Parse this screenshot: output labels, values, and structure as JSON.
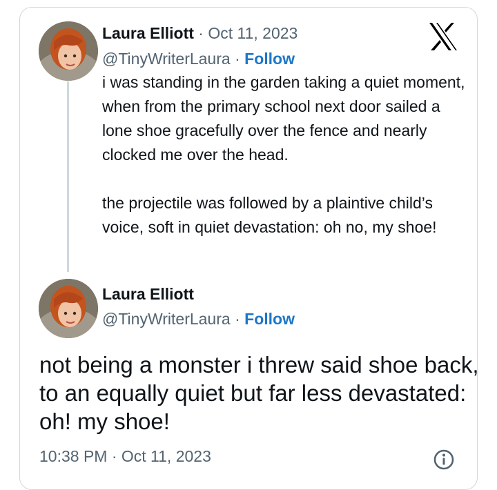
{
  "tweet1": {
    "author_name": "Laura Elliott",
    "separator": "·",
    "date": "Oct 11, 2023",
    "handle": "@TinyWriterLaura",
    "follow_label": "Follow",
    "paragraph1": "i was standing in the garden taking a quiet moment, when from the primary school next door sailed a lone shoe gracefully over the fence and nearly clocked me over the head.",
    "paragraph2": "the projectile was followed by a plaintive child’s voice, soft in quiet devastation: oh no, my shoe!"
  },
  "tweet2": {
    "author_name": "Laura Elliott",
    "handle": "@TinyWriterLaura",
    "separator": "·",
    "follow_label": "Follow",
    "text": "not being a monster i threw said shoe back, to an equally quiet but far less devastated: oh! my shoe!",
    "timestamp": "10:38 PM · Oct 11, 2023"
  },
  "icons": {
    "brand": "x-logo-icon",
    "info": "info-icon"
  },
  "colors": {
    "link": "#1d77c9",
    "secondary_text": "#536471",
    "border": "#cfd9de"
  }
}
